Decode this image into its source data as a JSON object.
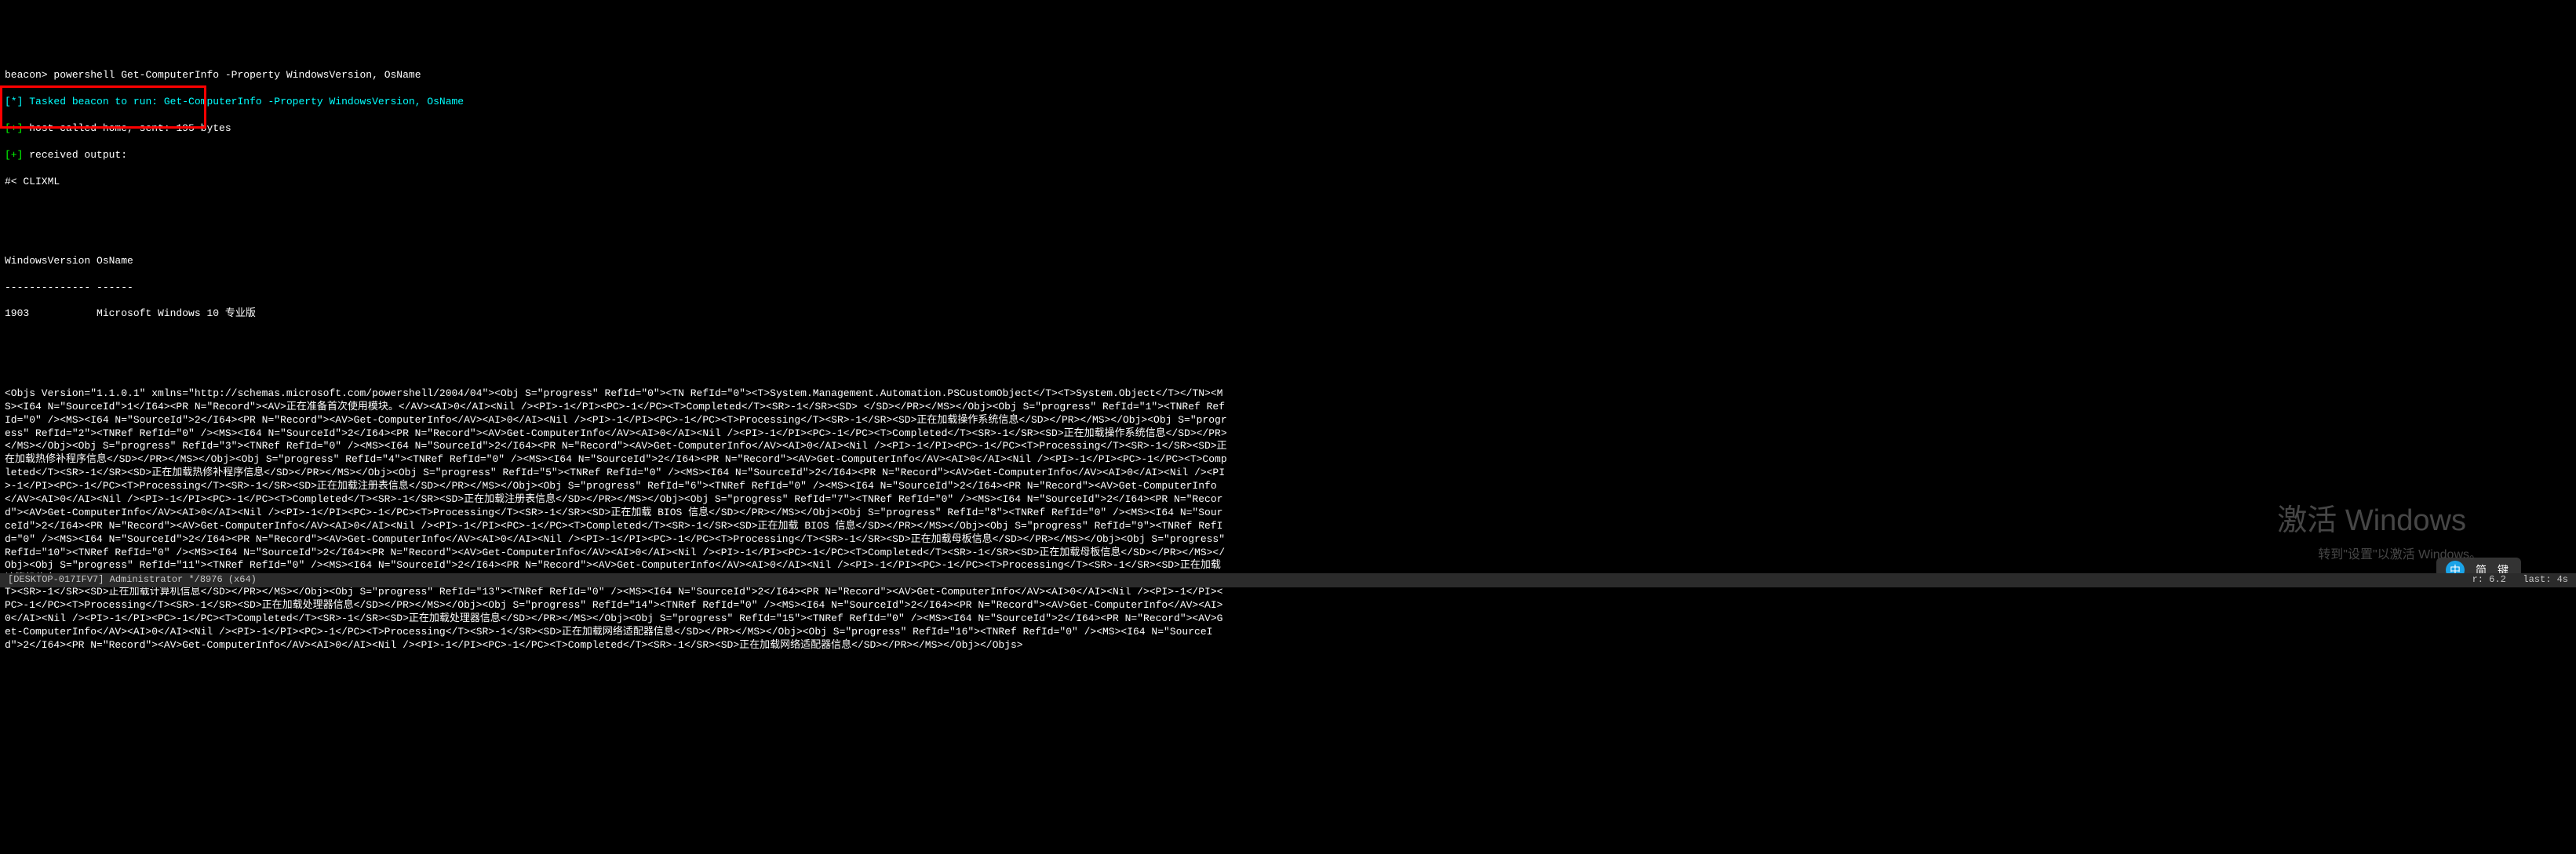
{
  "prompt": {
    "label": "beacon>",
    "command": "powershell Get-ComputerInfo -Property WindowsVersion, OsName"
  },
  "log": {
    "tasked_prefix": "[*]",
    "tasked": "Tasked beacon to run: Get-ComputerInfo -Property WindowsVersion, OsName",
    "home_prefix": "[+]",
    "home": "host called home, sent: 195 bytes",
    "recv_prefix": "[+]",
    "recv": "received output:",
    "clixml": "#< CLIXML"
  },
  "table": {
    "header": "WindowsVersion OsName",
    "sep": "-------------- ------",
    "row": "1903           Microsoft Windows 10 专业版"
  },
  "xml_output": "<Objs Version=\"1.1.0.1\" xmlns=\"http://schemas.microsoft.com/powershell/2004/04\"><Obj S=\"progress\" RefId=\"0\"><TN RefId=\"0\"><T>System.Management.Automation.PSCustomObject</T><T>System.Object</T></TN><MS><I64 N=\"SourceId\">1</I64><PR N=\"Record\"><AV>正在准备首次使用模块。</AV><AI>0</AI><Nil /><PI>-1</PI><PC>-1</PC><T>Completed</T><SR>-1</SR><SD> </SD></PR></MS></Obj><Obj S=\"progress\" RefId=\"1\"><TNRef RefId=\"0\" /><MS><I64 N=\"SourceId\">2</I64><PR N=\"Record\"><AV>Get-ComputerInfo</AV><AI>0</AI><Nil /><PI>-1</PI><PC>-1</PC><T>Processing</T><SR>-1</SR><SD>正在加载操作系统信息</SD></PR></MS></Obj><Obj S=\"progress\" RefId=\"2\"><TNRef RefId=\"0\" /><MS><I64 N=\"SourceId\">2</I64><PR N=\"Record\"><AV>Get-ComputerInfo</AV><AI>0</AI><Nil /><PI>-1</PI><PC>-1</PC><T>Completed</T><SR>-1</SR><SD>正在加载操作系统信息</SD></PR></MS></Obj><Obj S=\"progress\" RefId=\"3\"><TNRef RefId=\"0\" /><MS><I64 N=\"SourceId\">2</I64><PR N=\"Record\"><AV>Get-ComputerInfo</AV><AI>0</AI><Nil /><PI>-1</PI><PC>-1</PC><T>Processing</T><SR>-1</SR><SD>正在加载热修补程序信息</SD></PR></MS></Obj><Obj S=\"progress\" RefId=\"4\"><TNRef RefId=\"0\" /><MS><I64 N=\"SourceId\">2</I64><PR N=\"Record\"><AV>Get-ComputerInfo</AV><AI>0</AI><Nil /><PI>-1</PI><PC>-1</PC><T>Completed</T><SR>-1</SR><SD>正在加载热修补程序信息</SD></PR></MS></Obj><Obj S=\"progress\" RefId=\"5\"><TNRef RefId=\"0\" /><MS><I64 N=\"SourceId\">2</I64><PR N=\"Record\"><AV>Get-ComputerInfo</AV><AI>0</AI><Nil /><PI>-1</PI><PC>-1</PC><T>Processing</T><SR>-1</SR><SD>正在加载注册表信息</SD></PR></MS></Obj><Obj S=\"progress\" RefId=\"6\"><TNRef RefId=\"0\" /><MS><I64 N=\"SourceId\">2</I64><PR N=\"Record\"><AV>Get-ComputerInfo</AV><AI>0</AI><Nil /><PI>-1</PI><PC>-1</PC><T>Completed</T><SR>-1</SR><SD>正在加载注册表信息</SD></PR></MS></Obj><Obj S=\"progress\" RefId=\"7\"><TNRef RefId=\"0\" /><MS><I64 N=\"SourceId\">2</I64><PR N=\"Record\"><AV>Get-ComputerInfo</AV><AI>0</AI><Nil /><PI>-1</PI><PC>-1</PC><T>Processing</T><SR>-1</SR><SD>正在加载 BIOS 信息</SD></PR></MS></Obj><Obj S=\"progress\" RefId=\"8\"><TNRef RefId=\"0\" /><MS><I64 N=\"SourceId\">2</I64><PR N=\"Record\"><AV>Get-ComputerInfo</AV><AI>0</AI><Nil /><PI>-1</PI><PC>-1</PC><T>Completed</T><SR>-1</SR><SD>正在加载 BIOS 信息</SD></PR></MS></Obj><Obj S=\"progress\" RefId=\"9\"><TNRef RefId=\"0\" /><MS><I64 N=\"SourceId\">2</I64><PR N=\"Record\"><AV>Get-ComputerInfo</AV><AI>0</AI><Nil /><PI>-1</PI><PC>-1</PC><T>Processing</T><SR>-1</SR><SD>正在加载母板信息</SD></PR></MS></Obj><Obj S=\"progress\" RefId=\"10\"><TNRef RefId=\"0\" /><MS><I64 N=\"SourceId\">2</I64><PR N=\"Record\"><AV>Get-ComputerInfo</AV><AI>0</AI><Nil /><PI>-1</PI><PC>-1</PC><T>Completed</T><SR>-1</SR><SD>正在加载母板信息</SD></PR></MS></Obj><Obj S=\"progress\" RefId=\"11\"><TNRef RefId=\"0\" /><MS><I64 N=\"SourceId\">2</I64><PR N=\"Record\"><AV>Get-ComputerInfo</AV><AI>0</AI><Nil /><PI>-1</PI><PC>-1</PC><T>Processing</T><SR>-1</SR><SD>正在加载计算机信息</SD></PR></MS></Obj><Obj S=\"progress\" RefId=\"12\"><TNRef RefId=\"0\" /><MS><I64 N=\"SourceId\">2</I64><PR N=\"Record\"><AV>Get-ComputerInfo</AV><AI>0</AI><Nil /><PI>-1</PI><PC>-1</PC><T>Completed</T><SR>-1</SR><SD>正在加载计算机信息</SD></PR></MS></Obj><Obj S=\"progress\" RefId=\"13\"><TNRef RefId=\"0\" /><MS><I64 N=\"SourceId\">2</I64><PR N=\"Record\"><AV>Get-ComputerInfo</AV><AI>0</AI><Nil /><PI>-1</PI><PC>-1</PC><T>Processing</T><SR>-1</SR><SD>正在加载处理器信息</SD></PR></MS></Obj><Obj S=\"progress\" RefId=\"14\"><TNRef RefId=\"0\" /><MS><I64 N=\"SourceId\">2</I64><PR N=\"Record\"><AV>Get-ComputerInfo</AV><AI>0</AI><Nil /><PI>-1</PI><PC>-1</PC><T>Completed</T><SR>-1</SR><SD>正在加载处理器信息</SD></PR></MS></Obj><Obj S=\"progress\" RefId=\"15\"><TNRef RefId=\"0\" /><MS><I64 N=\"SourceId\">2</I64><PR N=\"Record\"><AV>Get-ComputerInfo</AV><AI>0</AI><Nil /><PI>-1</PI><PC>-1</PC><T>Processing</T><SR>-1</SR><SD>正在加载网络适配器信息</SD></PR></MS></Obj><Obj S=\"progress\" RefId=\"16\"><TNRef RefId=\"0\" /><MS><I64 N=\"SourceId\">2</I64><PR N=\"Record\"><AV>Get-ComputerInfo</AV><AI>0</AI><Nil /><PI>-1</PI><PC>-1</PC><T>Completed</T><SR>-1</SR><SD>正在加载网络适配器信息</SD></PR></MS></Obj></Objs>",
  "watermark": {
    "title": "激活 Windows",
    "subtitle": "转到\"设置\"以激活 Windows。"
  },
  "ime": {
    "glyph": "中",
    "word1": "简",
    "word2": "键"
  },
  "status": {
    "left": "[DESKTOP-017IFV7] Administrator */8976 (x64)",
    "right": "r: 6.2   last: 4s"
  }
}
